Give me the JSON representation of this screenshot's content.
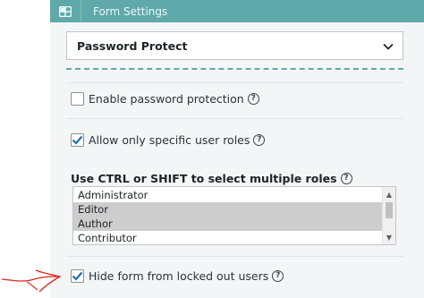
{
  "header": {
    "title": "Form Settings",
    "icon": "grid-icon",
    "background": "#5fa9ab"
  },
  "section_select": {
    "value": "Password Protect",
    "icon": "chevron-down-icon"
  },
  "options": {
    "enable_password": {
      "label": "Enable password protection",
      "checked": false
    },
    "specific_roles": {
      "label": "Allow only specific user roles",
      "checked": true
    },
    "hide_locked": {
      "label": "Hide form from locked out users",
      "checked": true
    }
  },
  "roles": {
    "title": "Use CTRL or SHIFT to select multiple roles",
    "items": [
      {
        "label": "Administrator",
        "selected": false
      },
      {
        "label": "Editor",
        "selected": true
      },
      {
        "label": "Author",
        "selected": true
      },
      {
        "label": "Contributor",
        "selected": false
      }
    ]
  },
  "annotation": {
    "arrow_color": "#e0261c"
  }
}
